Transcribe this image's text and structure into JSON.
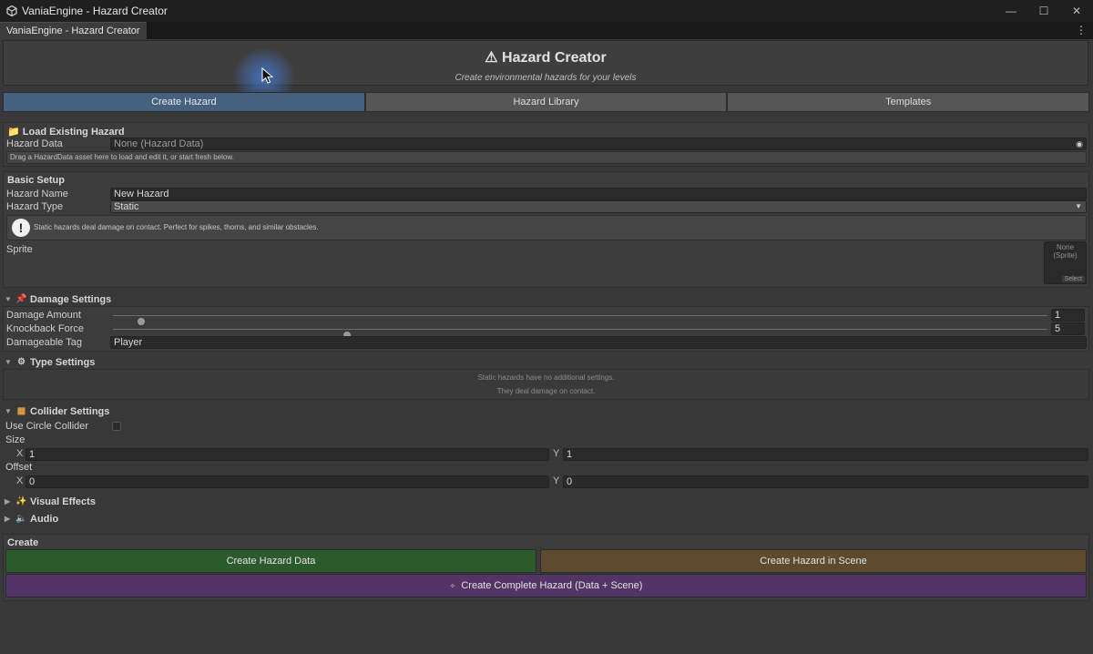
{
  "window": {
    "title": "VaniaEngine - Hazard Creator"
  },
  "editor_tab": {
    "label": "VaniaEngine - Hazard Creator"
  },
  "header": {
    "title": "Hazard Creator",
    "subtitle": "Create environmental hazards for your levels"
  },
  "toolbar": {
    "tabs": [
      {
        "label": "Create Hazard",
        "active": true
      },
      {
        "label": "Hazard Library",
        "active": false
      },
      {
        "label": "Templates",
        "active": false
      }
    ]
  },
  "load_section": {
    "title": "Load Existing Hazard",
    "field_label": "Hazard Data",
    "field_value": "None (Hazard Data)",
    "help": "Drag a HazardData asset here to load and edit it, or start fresh below."
  },
  "basic_setup": {
    "title": "Basic Setup",
    "name_label": "Hazard Name",
    "name_value": "New Hazard",
    "type_label": "Hazard Type",
    "type_value": "Static",
    "info": "Static hazards deal damage on contact. Perfect for spikes, thorns, and similar obstacles.",
    "sprite_label": "Sprite",
    "sprite_value": "None (Sprite)",
    "sprite_select": "Select"
  },
  "damage_settings": {
    "title": "Damage Settings",
    "damage_label": "Damage Amount",
    "damage_value": "1",
    "damage_fraction": 0.03,
    "knockback_label": "Knockback Force",
    "knockback_value": "5",
    "knockback_fraction": 0.25,
    "tag_label": "Damageable Tag",
    "tag_value": "Player"
  },
  "type_settings": {
    "title": "Type Settings",
    "line1": "Static hazards have no additional settings.",
    "line2": "They deal damage on contact."
  },
  "collider_settings": {
    "title": "Collider Settings",
    "circle_label": "Use Circle Collider",
    "circle_checked": false,
    "size_label": "Size",
    "size_x": "1",
    "size_y": "1",
    "offset_label": "Offset",
    "offset_x": "0",
    "offset_y": "0",
    "x_label": "X",
    "y_label": "Y"
  },
  "visual_effects": {
    "title": "Visual Effects"
  },
  "audio": {
    "title": "Audio"
  },
  "create_section": {
    "title": "Create",
    "data_button": "Create Hazard Data",
    "scene_button": "Create Hazard in Scene",
    "complete_button": "Create Complete Hazard (Data + Scene)",
    "colors": {
      "data": "#2b5a2d",
      "scene": "#5e4a2c",
      "complete": "#533466"
    }
  },
  "colors": {
    "accent_tab": "#46607f",
    "background": "#383838"
  },
  "icons": [
    "unity-icon",
    "minimize-icon",
    "maximize-icon",
    "close-icon",
    "kebab-menu-icon",
    "warning-icon",
    "folder-icon",
    "info-icon",
    "object-picker-icon",
    "dropdown-arrow-icon",
    "pin-icon",
    "gear-icon",
    "cube-icon",
    "sparkle-icon",
    "speaker-icon",
    "sparkle-small-icon"
  ]
}
